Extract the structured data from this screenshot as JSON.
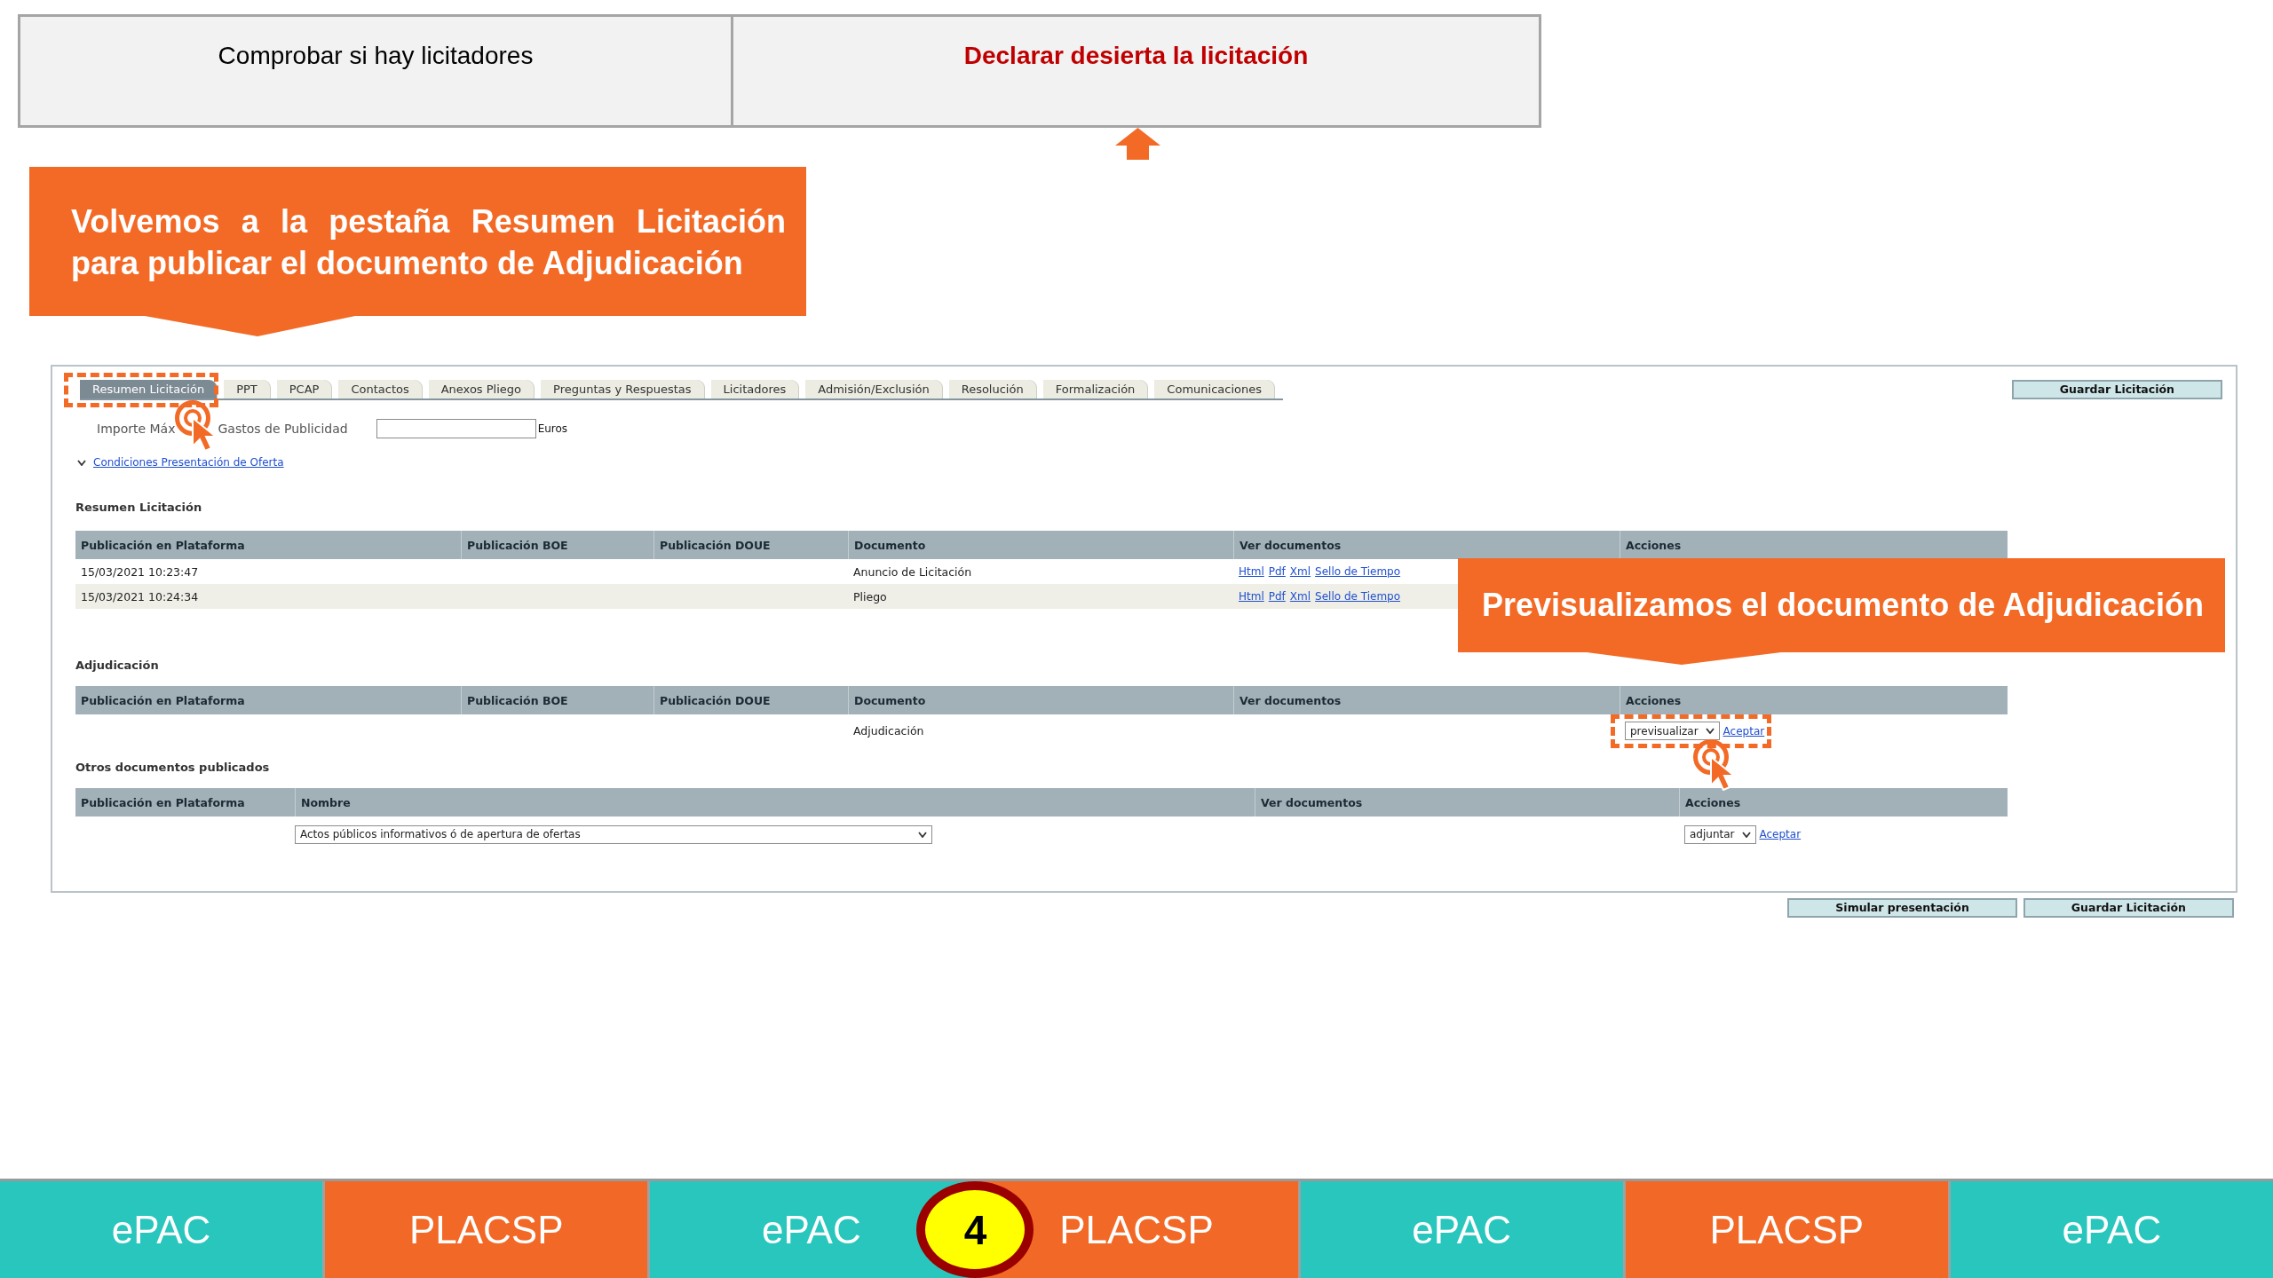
{
  "steps": [
    {
      "label": "Comprobar si hay licitadores",
      "selected": false
    },
    {
      "label": "Declarar desierta la licitación",
      "selected": true
    }
  ],
  "instruction_callout": {
    "text": "Volvemos a la pestaña Resumen Licitación para publicar el documento de Adjudicación"
  },
  "screenshot": {
    "tabs": [
      {
        "label": "Resumen Licitación",
        "selected": true,
        "highlighted": true
      },
      {
        "label": "PPT",
        "selected": false,
        "highlighted": false
      },
      {
        "label": "PCAP",
        "selected": false,
        "highlighted": false
      },
      {
        "label": "Contactos",
        "selected": false,
        "highlighted": false
      },
      {
        "label": "Anexos Pliego",
        "selected": false,
        "highlighted": false
      },
      {
        "label": "Preguntas y Respuestas",
        "selected": false,
        "highlighted": false
      },
      {
        "label": "Licitadores",
        "selected": false,
        "highlighted": false
      },
      {
        "label": "Admisión/Exclusión",
        "selected": false,
        "highlighted": false
      },
      {
        "label": "Resolución",
        "selected": false,
        "highlighted": false
      },
      {
        "label": "Formalización",
        "selected": false,
        "highlighted": false
      },
      {
        "label": "Comunicaciones",
        "selected": false,
        "highlighted": false
      }
    ],
    "save_button": "Guardar Licitación",
    "budget_field": {
      "label_parts": [
        "Importe Máx",
        "Gastos de Publicidad"
      ],
      "unit": "Euros"
    },
    "conditions_link": "Condiciones Presentación de Oferta",
    "summary": {
      "title": "Resumen Licitación",
      "columns": [
        "Publicación en Plataforma",
        "Publicación BOE",
        "Publicación DOUE",
        "Documento",
        "Ver documentos",
        "Acciones"
      ],
      "rows": [
        {
          "platform_date": "15/03/2021 10:23:47",
          "document": "Anuncio de Licitación",
          "links": [
            "Html",
            "Pdf",
            "Xml",
            "Sello de Tiempo"
          ]
        },
        {
          "platform_date": "15/03/2021 10:24:34",
          "document": "Pliego",
          "links": [
            "Html",
            "Pdf",
            "Xml",
            "Sello de Tiempo"
          ]
        }
      ]
    },
    "preview_callout": {
      "text": "Previsualizamos el documento de Adjudicación"
    },
    "award": {
      "title": "Adjudicación",
      "columns": [
        "Publicación en Plataforma",
        "Publicación BOE",
        "Publicación DOUE",
        "Documento",
        "Ver documentos",
        "Acciones"
      ],
      "rows": [
        {
          "document": "Adjudicación",
          "action": {
            "option": "previsualizar",
            "link": "Aceptar",
            "highlighted": true
          }
        }
      ]
    },
    "other_documents": {
      "title": "Otros documentos publicados",
      "columns": [
        "Publicación en Plataforma",
        "Nombre",
        "Ver documentos",
        "Acciones"
      ],
      "rows": [
        {
          "name_option": "Actos públicos informativos ó de apertura de ofertas",
          "action": {
            "option": "adjuntar",
            "link": "Aceptar",
            "highlighted": false
          }
        }
      ]
    }
  },
  "form_buttons": [
    "Simular presentación",
    "Guardar Licitación"
  ],
  "footer": [
    {
      "label": "ePAC",
      "color": "#29c6bd"
    },
    {
      "label": "PLACSP",
      "color": "#f26826"
    },
    {
      "label": "ePAC",
      "color": "#29c6bd"
    },
    {
      "label": "PLACSP",
      "color": "#f26826",
      "badge": "4"
    },
    {
      "label": "ePAC",
      "color": "#29c6bd"
    },
    {
      "label": "PLACSP",
      "color": "#f26826"
    },
    {
      "label": "ePAC",
      "color": "#29c6bd"
    }
  ]
}
